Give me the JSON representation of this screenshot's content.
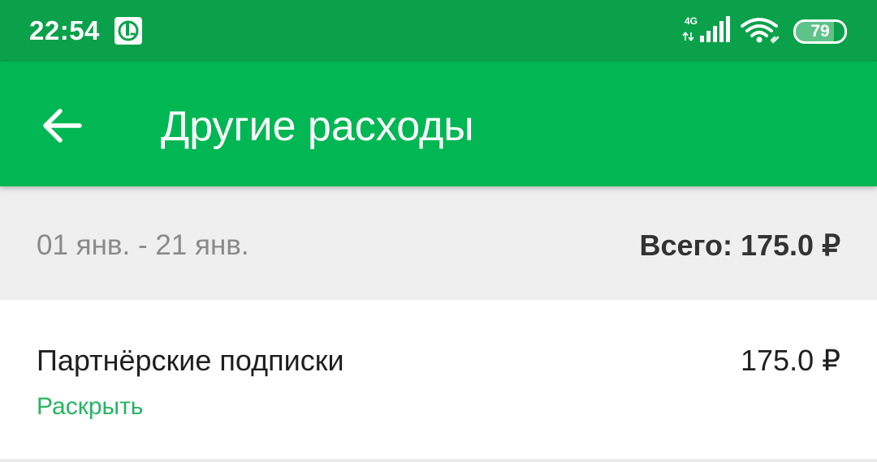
{
  "status_bar": {
    "time": "22:54",
    "network": "4G",
    "battery": "79",
    "battery_level": 0.79,
    "icons": [
      "carrier-app-icon",
      "signal-icon",
      "wifi-icon",
      "battery-icon"
    ]
  },
  "app_bar": {
    "back_icon": "arrow-left-icon",
    "title": "Другие расходы"
  },
  "summary": {
    "period": "01 янв. - 21 янв.",
    "total": "Всего: 175.0 ₽"
  },
  "items": [
    {
      "name": "Партнёрские подписки",
      "amount": "175.0 ₽",
      "expand_label": "Раскрыть"
    }
  ],
  "colors": {
    "status_bar": "#0aa14a",
    "app_bar": "#00b753",
    "summary_bg": "#efefef",
    "accent_link": "#27b463"
  }
}
